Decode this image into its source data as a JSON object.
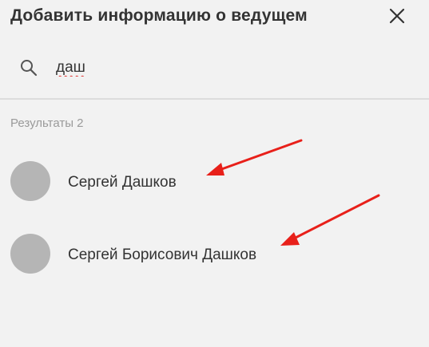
{
  "dialog": {
    "title": "Добавить информацию о ведущем",
    "close_icon": "close-icon"
  },
  "search": {
    "icon": "search-icon",
    "value": "даш"
  },
  "results": {
    "count_label": "Результаты 2",
    "items": [
      {
        "name": "Сергей Дашков"
      },
      {
        "name": "Сергей Борисович Дашков"
      }
    ]
  },
  "annotations": {
    "arrow_color": "#e8201a"
  }
}
